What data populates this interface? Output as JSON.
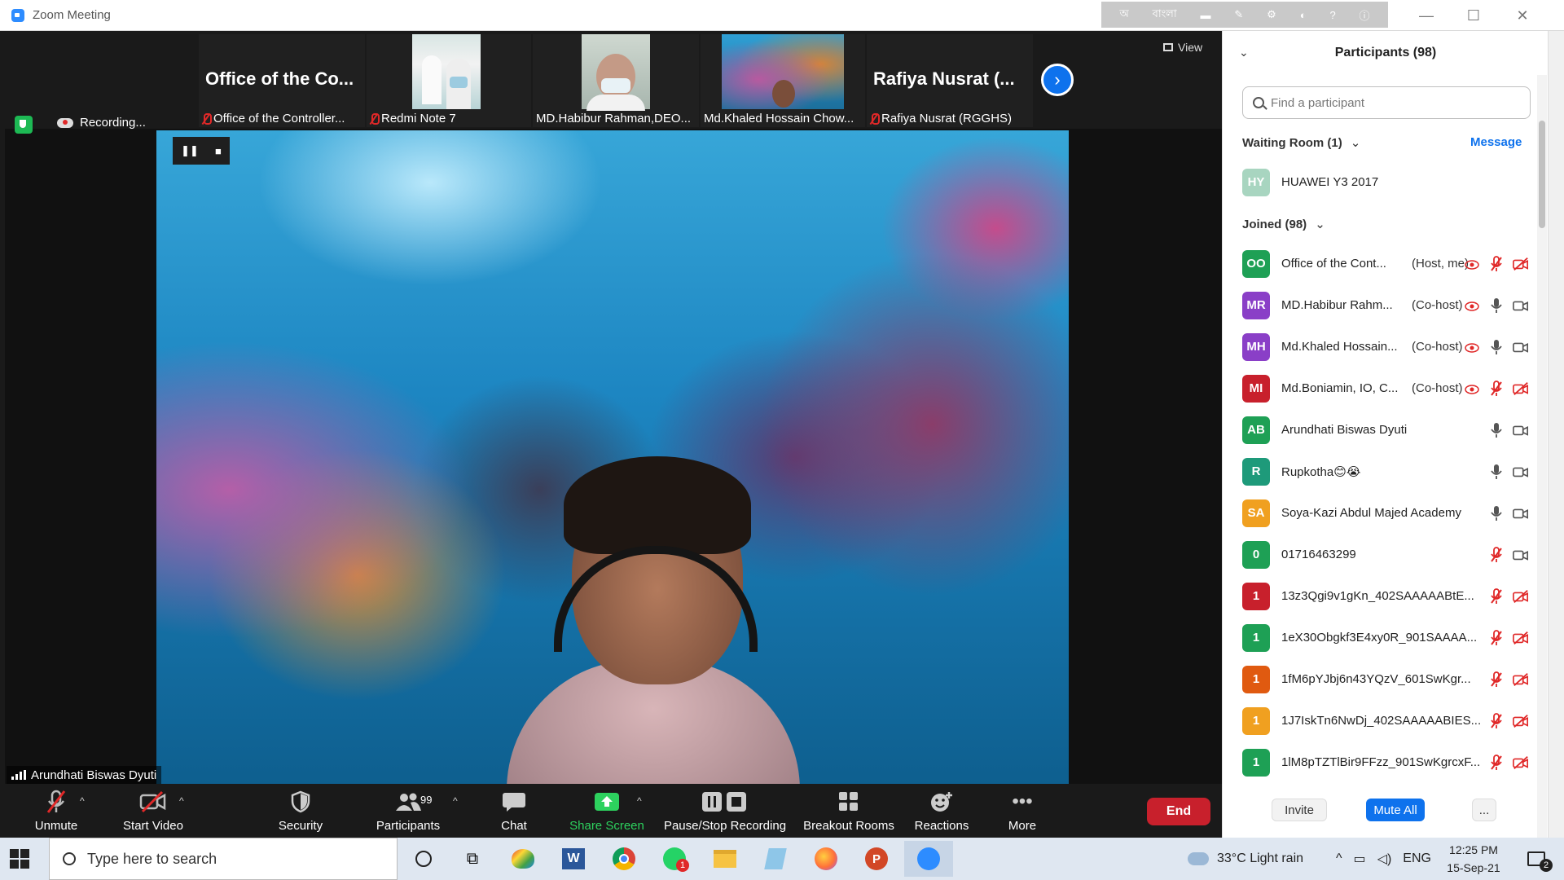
{
  "window": {
    "title": "Zoom Meeting",
    "lang_label": "বাংলা",
    "lang_char": "অ"
  },
  "top_strip": {
    "view_label": "View",
    "tiles": [
      {
        "big": "Office of the Co...",
        "caption": "Office of the Controller...",
        "muted": true
      },
      {
        "caption": "Redmi Note 7",
        "muted": true
      },
      {
        "caption": "MD.Habibur Rahman,DEO...",
        "muted": false
      },
      {
        "caption": "Md.Khaled Hossain Chow...",
        "muted": false
      },
      {
        "big": "Rafiya Nusrat (...",
        "caption": "Rafiya Nusrat (RGGHS)",
        "muted": true
      }
    ]
  },
  "main": {
    "recording_label": "Recording...",
    "speaker_name": "Arundhati Biswas Dyuti"
  },
  "toolbar": {
    "unmute": "Unmute",
    "start_video": "Start Video",
    "security": "Security",
    "participants": "Participants",
    "participants_count": "99",
    "chat": "Chat",
    "share_screen": "Share Screen",
    "pause_stop_recording": "Pause/Stop Recording",
    "breakout_rooms": "Breakout Rooms",
    "reactions": "Reactions",
    "more": "More",
    "end": "End"
  },
  "panel": {
    "title": "Participants (98)",
    "search_placeholder": "Find a participant",
    "waiting_room_label": "Waiting Room (1)",
    "message_label": "Message",
    "waiting": [
      {
        "initials": "HY",
        "name": "HUAWEI Y3 2017",
        "color": "#a8d5c0"
      }
    ],
    "joined_label": "Joined (98)",
    "joined": [
      {
        "initials": "OO",
        "name": "Office of the Cont...",
        "role": "(Host, me)",
        "color": "#1ea055",
        "rec": true,
        "mic": "off",
        "cam": "off"
      },
      {
        "initials": "MR",
        "name": "MD.Habibur Rahm...",
        "role": "(Co-host)",
        "color": "#8a3fc7",
        "rec": true,
        "mic": "on",
        "cam": "on"
      },
      {
        "initials": "MH",
        "name": "Md.Khaled Hossain...",
        "role": "(Co-host)",
        "color": "#8a3fc7",
        "rec": true,
        "mic": "on",
        "cam": "on"
      },
      {
        "initials": "MI",
        "name": "Md.Boniamin, IO, C...",
        "role": "(Co-host)",
        "color": "#c8202c",
        "rec": true,
        "mic": "off",
        "cam": "off"
      },
      {
        "initials": "AB",
        "name": "Arundhati Biswas Dyuti",
        "role": "",
        "color": "#1ea055",
        "rec": false,
        "mic": "on",
        "cam": "on"
      },
      {
        "initials": "R",
        "name": "Rupkotha😊😭",
        "role": "",
        "color": "#1e9a7a",
        "rec": false,
        "mic": "on",
        "cam": "on"
      },
      {
        "initials": "SA",
        "name": "Soya-Kazi Abdul Majed Academy",
        "role": "",
        "color": "#f0a020",
        "rec": false,
        "mic": "on",
        "cam": "on"
      },
      {
        "initials": "0",
        "name": "01716463299",
        "role": "",
        "color": "#1ea055",
        "rec": false,
        "mic": "off",
        "cam": "on"
      },
      {
        "initials": "1",
        "name": "13z3Qgi9v1gKn_402SAAAAABtE...",
        "role": "",
        "color": "#c8202c",
        "rec": false,
        "mic": "off",
        "cam": "off"
      },
      {
        "initials": "1",
        "name": "1eX30Obgkf3E4xy0R_901SAAAA...",
        "role": "",
        "color": "#1ea055",
        "rec": false,
        "mic": "off",
        "cam": "off"
      },
      {
        "initials": "1",
        "name": "1fM6pYJbj6n43YQzV_601SwKgr...",
        "role": "",
        "color": "#e05a10",
        "rec": false,
        "mic": "off",
        "cam": "off"
      },
      {
        "initials": "1",
        "name": "1J7IskTn6NwDj_402SAAAAABIES...",
        "role": "",
        "color": "#f0a020",
        "rec": false,
        "mic": "off",
        "cam": "off"
      },
      {
        "initials": "1",
        "name": "1lM8pTZTlBir9FFzz_901SwKgrcxF...",
        "role": "",
        "color": "#1ea055",
        "rec": false,
        "mic": "off",
        "cam": "off"
      }
    ],
    "invite_label": "Invite",
    "mute_all_label": "Mute All",
    "more_label": "..."
  },
  "taskbar": {
    "search_placeholder": "Type here to search",
    "whatsapp_badge": "1",
    "weather": "33°C  Light rain",
    "lang": "ENG",
    "time": "12:25 PM",
    "date": "15-Sep-21",
    "notif_count": "2"
  }
}
